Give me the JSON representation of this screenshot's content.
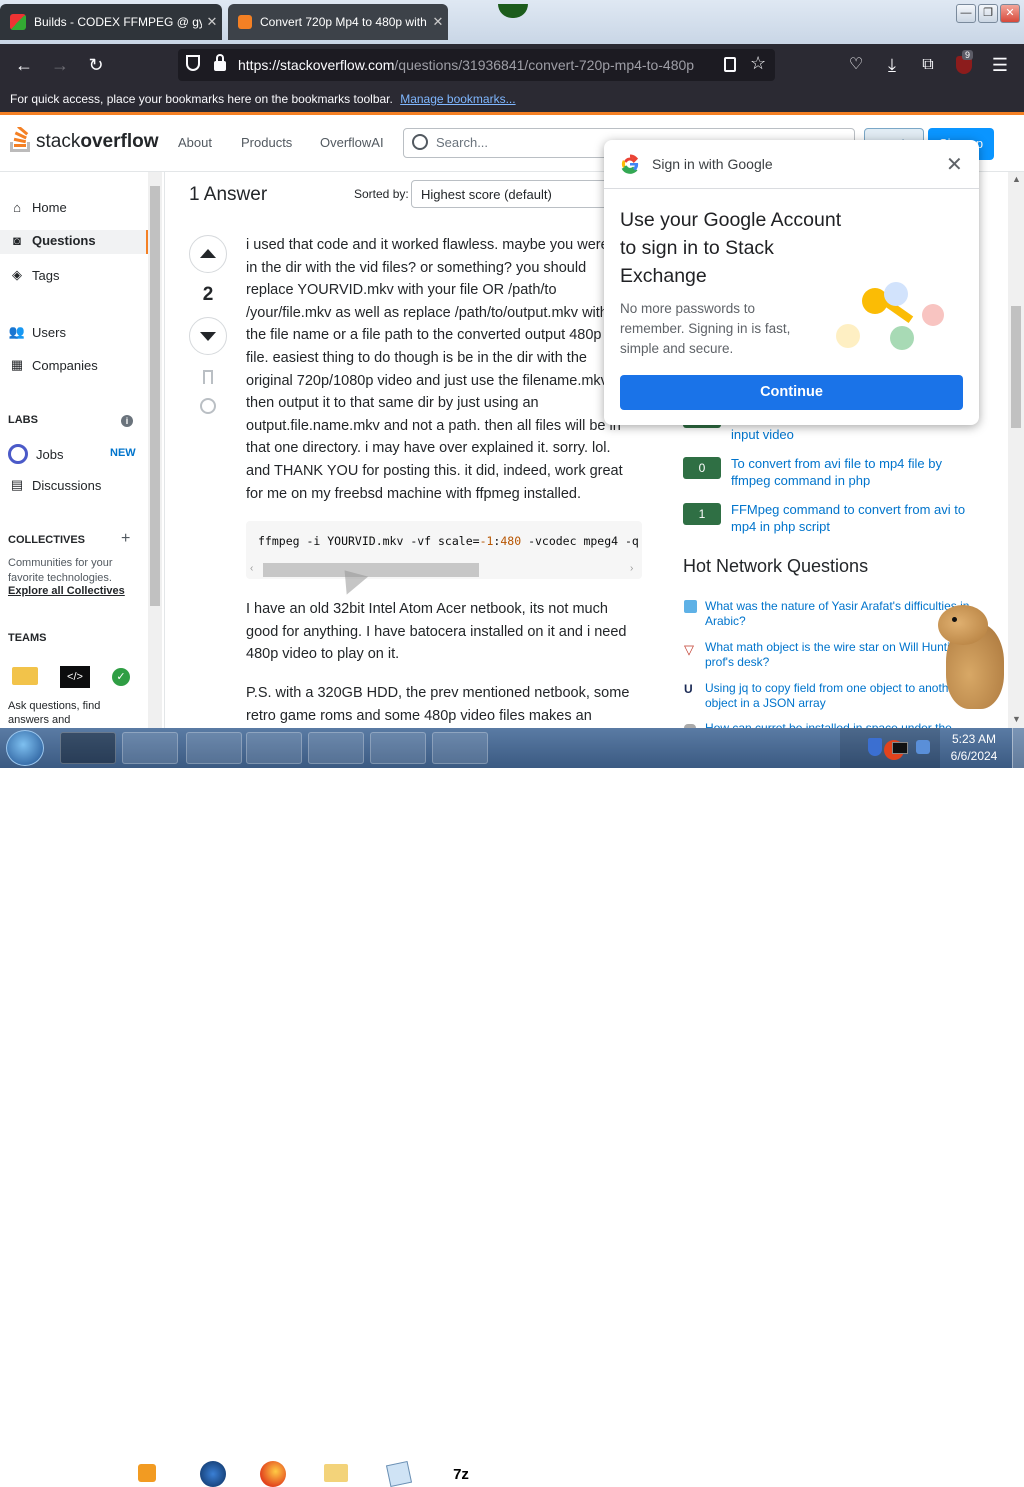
{
  "browser": {
    "tabs": [
      {
        "title": "Builds - CODEX FFMPEG @ gya"
      },
      {
        "title": "Convert 720p Mp4 to 480p with"
      }
    ],
    "url_host": "https://stackoverflow.com",
    "url_path": "/questions/31936841/convert-720p-mp4-to-480p",
    "extension_badge": "9",
    "bookmarks_bar_text": "For quick access, place your bookmarks here on the bookmarks toolbar.",
    "bookmarks_bar_link": "Manage bookmarks..."
  },
  "so_header": {
    "logo_light": "stack",
    "logo_bold": "overflow",
    "nav": [
      "About",
      "Products",
      "OverflowAI"
    ],
    "search_placeholder": "Search...",
    "login_label": "Log in",
    "signup_label": "Sign up"
  },
  "sidebar": {
    "home": "Home",
    "questions": "Questions",
    "tags": "Tags",
    "users": "Users",
    "companies": "Companies",
    "labs_heading": "LABS",
    "jobs": "Jobs",
    "jobs_badge": "NEW",
    "discussions": "Discussions",
    "collectives_heading": "COLLECTIVES",
    "collectives_desc": "Communities for your favorite technologies.",
    "collectives_link": "Explore all Collectives",
    "teams_heading": "TEAMS",
    "teams_desc": "Ask questions, find answers and"
  },
  "answers_header": {
    "count_title": "1 Answer",
    "sorted_by_label": "Sorted by:",
    "sort_value": "Highest score (default)"
  },
  "answer": {
    "score": "2",
    "lines": [
      "i used that code and it worked flawless. maybe you were",
      "in the dir with the vid files? or something? you should",
      "replace YOURVID.mkv with your file OR /path/to",
      "/your/file.mkv as well as replace /path/to/output.mkv with",
      "the file name or a file path to the converted output 480p",
      "file. easiest thing to do though is be in the dir with the",
      "original 720p/1080p video and just use the filename.mkv",
      "then output it to that same dir by just using an",
      "output.file.name.mkv and not a path. then all files will be in",
      "that one directory. i may have over explained it. sorry. lol.",
      "and THANK YOU for posting this. it did, indeed, work great",
      "for me on my freebsd machine with ffpmeg installed."
    ],
    "code_before": "ffmpeg -i YOURVID.mkv -vf scale=",
    "code_num1": "-1",
    "code_colon": ":",
    "code_num2": "480",
    "code_after": " -vcodec mpeg4 -q",
    "para2_lines": [
      "I have an old 32bit Intel Atom Acer netbook, its not much",
      "good for anything. I have batocera installed on it and i need",
      "480p video to play on it."
    ],
    "para3_lines": [
      "P.S. with a 320GB HDD, the prev mentioned netbook, some",
      "retro game roms and some 480p video files makes an"
    ]
  },
  "related": [
    {
      "votes": "",
      "title": "input video"
    },
    {
      "votes": "0",
      "title": "To convert from avi file to mp4 file by ffmpeg command in php"
    },
    {
      "votes": "1",
      "title": "FFMpeg command to convert from avi to mp4 in php script"
    }
  ],
  "hot_network": {
    "heading": "Hot Network Questions",
    "items": [
      "What was the nature of Yasir Arafat's difficulties in Arabic?",
      "What math object is the wire star on Will Hunting's prof's desk?",
      "Using jq to copy field from one object to another object in a JSON array",
      "How can curret be installed in space under the"
    ]
  },
  "google_popup": {
    "header": "Sign in with Google",
    "title_lines": [
      "Use your Google Account",
      "to sign in to Stack",
      "Exchange"
    ],
    "body_lines": [
      "No more passwords to",
      "remember. Signing in is fast,",
      "simple and secure."
    ],
    "button": "Continue"
  },
  "taskbar": {
    "time": "5:23 AM",
    "date": "6/6/2024",
    "zip_label": "7z"
  },
  "colors": {
    "so_orange": "#f48024",
    "so_blue_button": "#0a95ff",
    "google_blue": "#1a73e8",
    "vote_green": "#2f6f44",
    "firefox_dark": "#2b2a33"
  }
}
